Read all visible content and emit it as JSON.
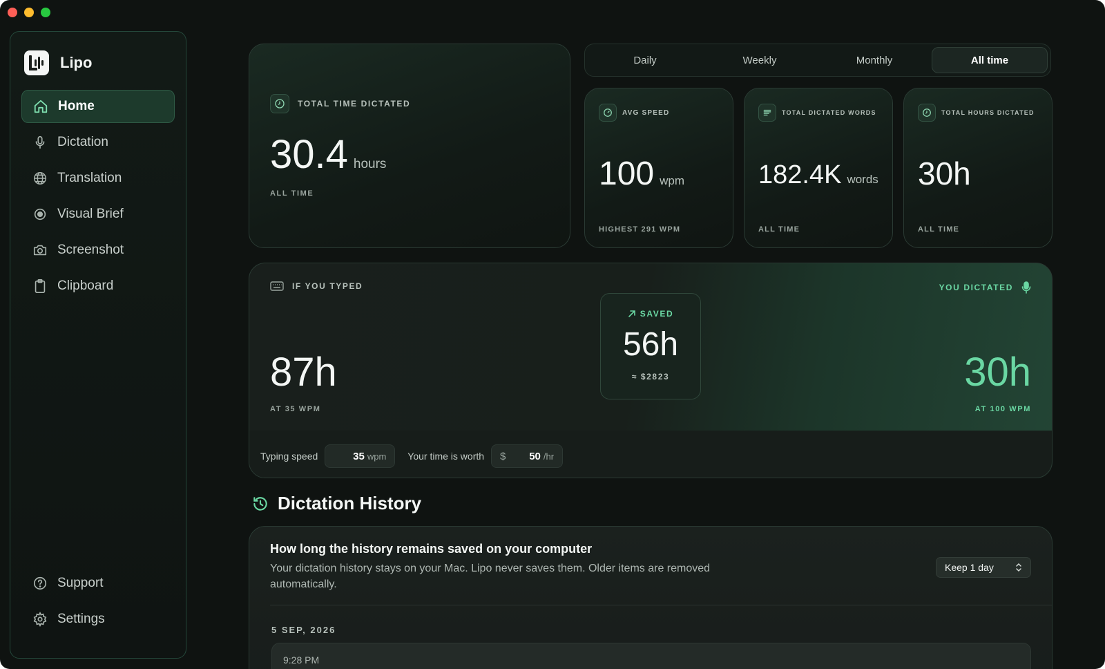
{
  "app": {
    "name": "Lipo"
  },
  "sidebar": {
    "items": [
      {
        "label": "Home",
        "icon": "home-icon",
        "active": true
      },
      {
        "label": "Dictation",
        "icon": "microphone-icon"
      },
      {
        "label": "Translation",
        "icon": "globe-icon"
      },
      {
        "label": "Visual Brief",
        "icon": "record-icon"
      },
      {
        "label": "Screenshot",
        "icon": "camera-icon"
      },
      {
        "label": "Clipboard",
        "icon": "clipboard-icon"
      }
    ],
    "bottom": [
      {
        "label": "Support",
        "icon": "help-icon"
      },
      {
        "label": "Settings",
        "icon": "gear-icon"
      }
    ]
  },
  "total_time": {
    "label": "TOTAL TIME DICTATED",
    "value": "30.4",
    "unit": "hours",
    "footer": "ALL TIME"
  },
  "period_tabs": {
    "items": [
      "Daily",
      "Weekly",
      "Monthly",
      "All time"
    ],
    "selected": "All time"
  },
  "stats": [
    {
      "label": "AVG SPEED",
      "value": "100",
      "unit": "wpm",
      "footer": "HIGHEST 291 WPM"
    },
    {
      "label": "TOTAL DICTATED WORDS",
      "value": "182.4K",
      "unit": "words",
      "footer": "ALL TIME"
    },
    {
      "label": "TOTAL HOURS DICTATED",
      "value": "30h",
      "unit": "",
      "footer": "ALL TIME"
    }
  ],
  "comparison": {
    "typed_label": "IF YOU TYPED",
    "typed_value": "87h",
    "typed_footer": "AT 35 WPM",
    "saved_label": "SAVED",
    "saved_value": "56h",
    "saved_money": "≈ $2823",
    "dictated_label": "YOU DICTATED",
    "dictated_value": "30h",
    "dictated_footer": "AT 100 WPM",
    "typing_speed_label": "Typing speed",
    "typing_speed_value": "35",
    "typing_speed_unit": "wpm",
    "time_worth_label": "Your time is worth",
    "currency": "$",
    "time_worth_value": "50",
    "time_worth_unit": "/hr"
  },
  "history": {
    "title": "Dictation History",
    "retention_title": "How long the history remains saved on your computer",
    "retention_desc": "Your dictation history stays on your Mac. Lipo never saves them. Older items are removed automatically.",
    "retention_value": "Keep 1 day",
    "date": "5 SEP, 2026",
    "entries": [
      {
        "time": "9:28 PM"
      }
    ]
  },
  "colors": {
    "accent": "#5fd39a",
    "background": "#0f1311",
    "card": "#18201c"
  }
}
